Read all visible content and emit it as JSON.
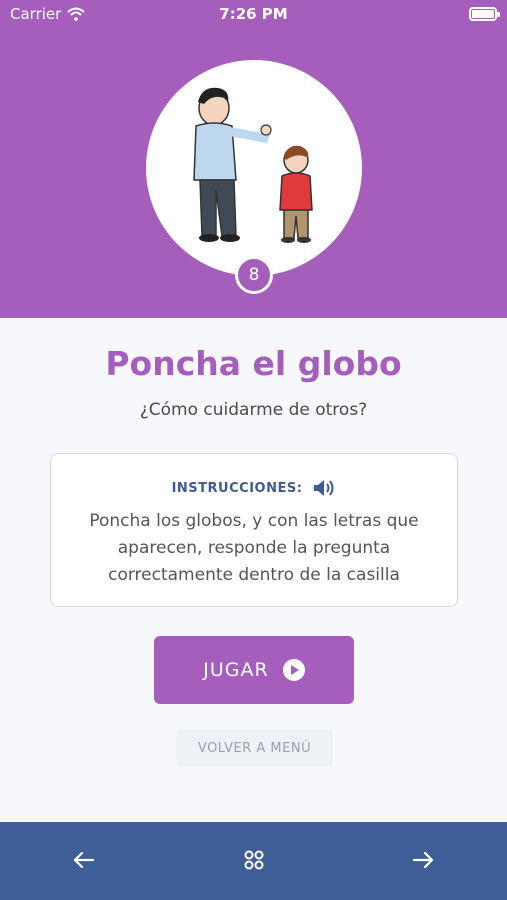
{
  "status_bar": {
    "carrier": "Carrier",
    "time": "7:26 PM"
  },
  "lesson": {
    "step_number": "8",
    "title": "Poncha el globo",
    "subtitle": "¿Cómo cuidarme de otros?"
  },
  "instructions": {
    "label": "INSTRUCCIONES:",
    "text": "Poncha los globos, y con las letras que aparecen, responde la pregunta correctamente dentro de la casilla"
  },
  "actions": {
    "play_label": "JUGAR",
    "menu_label": "VOLVER A MENÚ"
  },
  "bottom_nav": {
    "icons": [
      "arrow-left-icon",
      "grid-icon",
      "arrow-right-icon"
    ]
  },
  "colors": {
    "primary": "#a55ebb",
    "nav": "#3f5e97",
    "label": "#3d5a95"
  }
}
